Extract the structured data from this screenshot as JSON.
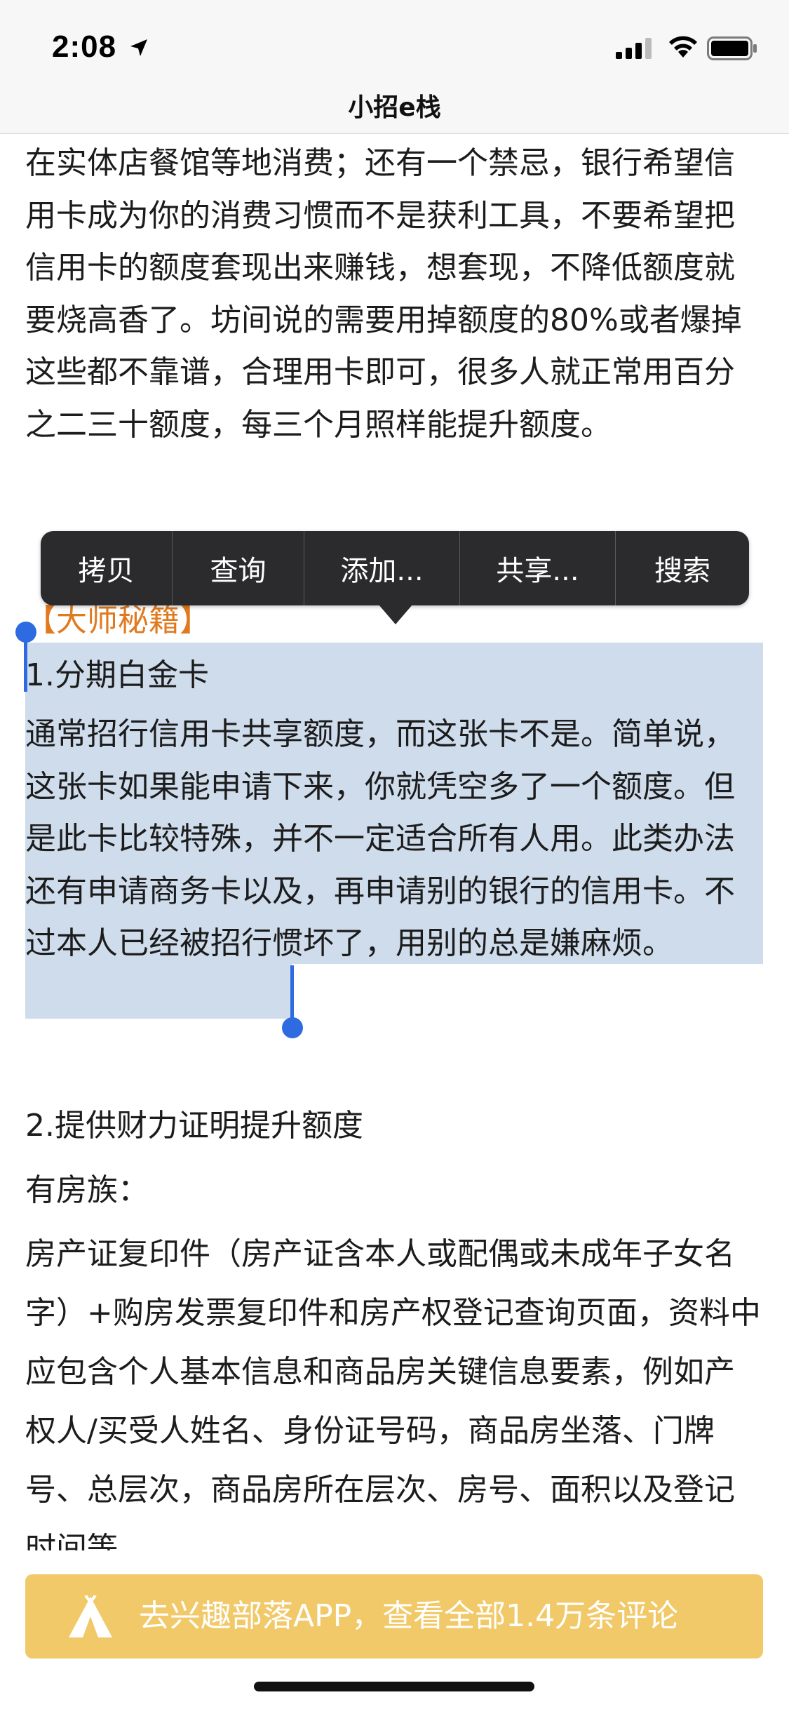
{
  "status_bar": {
    "time": "2:08"
  },
  "nav": {
    "title": "小招e栈"
  },
  "article": {
    "para1": "在实体店餐馆等地消费；还有一个禁忌，银行希望信用卡成为你的消费习惯而不是获利工具，不要希望把信用卡的额度套现出来赚钱，想套现，不降低额度就要烧高香了。坊间说的需要用掉额度的80%或者爆掉这些都不靠谱，合理用卡即可，很多人就正常用百分之二三十额度，每三个月照样能提升额度。",
    "heading": "【大师秘籍】",
    "section1_title": "1.分期白金卡",
    "section1_body": "通常招行信用卡共享额度，而这张卡不是。简单说，这张卡如果能申请下来，你就凭空多了一个额度。但是此卡比较特殊，并不一定适合所有人用。此类办法还有申请商务卡以及，再申请别的银行的信用卡。不过本人已经被招行惯坏了，用别的总是嫌麻烦。",
    "section2_title": "2.提供财力证明提升额度",
    "section2_sub": "有房族：",
    "section2_body": "房产证复印件（房产证含本人或配偶或未成年子女名字）+购房发票复印件和房产权登记查询页面，资料中应包含个人基本信息和商品房关键信息要素，例如产权人/买受人姓名、身份证号码，商品房坐落、门牌号、总层次，商品房所在层次、房号、面积以及登记时间等"
  },
  "context_menu": {
    "items": [
      "拷贝",
      "查询",
      "添加...",
      "共享...",
      "搜索"
    ]
  },
  "banner": {
    "text": "去兴趣部落APP，查看全部1.4万条评论"
  },
  "colors": {
    "selection": "#cfdcec",
    "handle": "#2e6be0",
    "banner": "#f1c969",
    "heading": "#e07a1f"
  }
}
